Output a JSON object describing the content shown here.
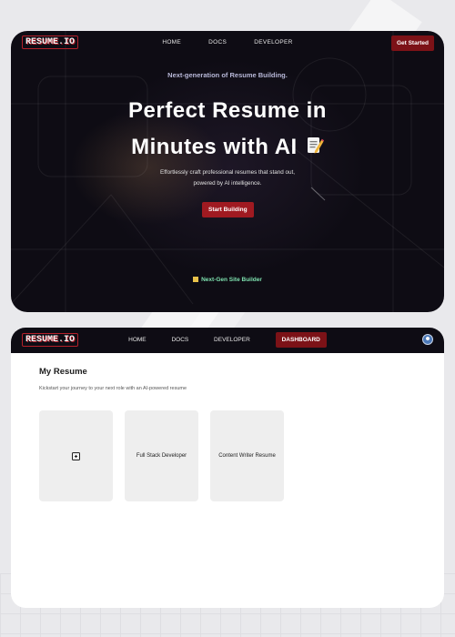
{
  "hero": {
    "logo": "RESUME.IO",
    "nav": [
      "HOME",
      "DOCS",
      "DEVELOPER"
    ],
    "cta_top": "Get Started",
    "tagline": "Next-generation of Resume Building.",
    "headline_line1": "Perfect Resume in",
    "headline_line2": "Minutes with AI",
    "subtext_line1": "Effortlessly craft professional resumes that stand out,",
    "subtext_line2": "powered by AI intelligence.",
    "cta_main": "Start Building",
    "badge": "Next-Gen Site Builder"
  },
  "dashboard": {
    "logo": "RESUME.IO",
    "nav": [
      "HOME",
      "DOCS",
      "DEVELOPER",
      "DASHBOARD"
    ],
    "active_nav": "DASHBOARD",
    "title": "My Resume",
    "subtitle": "Kickstart your journey to your next role with an AI-powered resume",
    "resumes": [
      "Full Stack Developer",
      "Content Writer Resume"
    ]
  },
  "colors": {
    "accent": "#7c1217",
    "hero_bg": "#0e0c14",
    "badge_text": "#7fe3b0"
  },
  "icons": [
    "memo-icon",
    "plus-square-icon",
    "user-avatar-icon",
    "cube-icon"
  ]
}
